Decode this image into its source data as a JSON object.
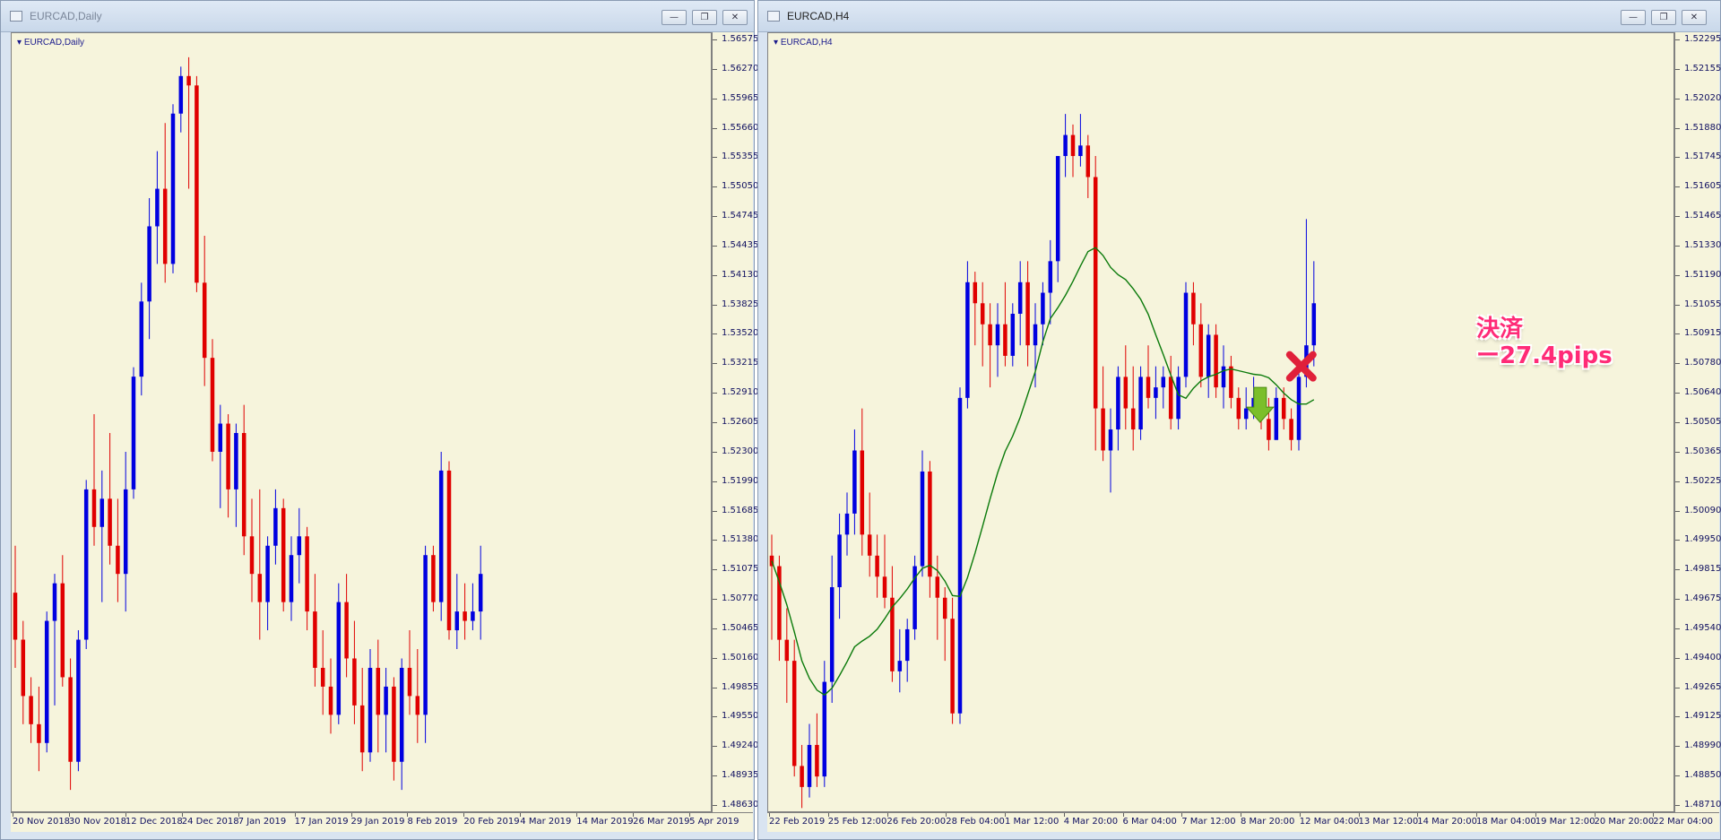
{
  "left_window": {
    "title": "EURCAD,Daily",
    "chart_label": "EURCAD,Daily",
    "price_labels": [
      "1.56575",
      "1.56270",
      "1.55965",
      "1.55660",
      "1.55355",
      "1.55050",
      "1.54745",
      "1.54435",
      "1.54130",
      "1.53825",
      "1.53520",
      "1.53215",
      "1.52910",
      "1.52605",
      "1.52300",
      "1.51990",
      "1.51685",
      "1.51380",
      "1.51075",
      "1.50770",
      "1.50465",
      "1.50160",
      "1.49855",
      "1.49550",
      "1.49240",
      "1.48935",
      "1.48630"
    ],
    "time_labels": [
      "20 Nov 2018",
      "30 Nov 2018",
      "12 Dec 2018",
      "24 Dec 2018",
      "7 Jan 2019",
      "17 Jan 2019",
      "29 Jan 2019",
      "8 Feb 2019",
      "20 Feb 2019",
      "4 Mar 2019",
      "14 Mar 2019",
      "26 Mar 2019",
      "5 Apr 2019"
    ]
  },
  "right_window": {
    "title": "EURCAD,H4",
    "chart_label": "EURCAD,H4",
    "price_labels": [
      "1.52295",
      "1.52155",
      "1.52020",
      "1.51880",
      "1.51745",
      "1.51605",
      "1.51465",
      "1.51330",
      "1.51190",
      "1.51055",
      "1.50915",
      "1.50780",
      "1.50640",
      "1.50505",
      "1.50365",
      "1.50225",
      "1.50090",
      "1.49950",
      "1.49815",
      "1.49675",
      "1.49540",
      "1.49400",
      "1.49265",
      "1.49125",
      "1.48990",
      "1.48850",
      "1.48710"
    ],
    "time_labels": [
      "22 Feb 2019",
      "25 Feb 12:00",
      "26 Feb 20:00",
      "28 Feb 04:00",
      "1 Mar 12:00",
      "4 Mar 20:00",
      "6 Mar 04:00",
      "7 Mar 12:00",
      "8 Mar 20:00",
      "12 Mar 04:00",
      "13 Mar 12:00",
      "14 Mar 20:00",
      "18 Mar 04:00",
      "19 Mar 12:00",
      "20 Mar 20:00",
      "22 Mar 04:00"
    ],
    "annotation": {
      "line1": "決済",
      "line2": "ー27.4pips"
    }
  },
  "window_buttons": {
    "minimize": "—",
    "restore": "❐",
    "close": "✕"
  },
  "colors": {
    "bull": "#0000e0",
    "bear": "#e00000",
    "ma": "#0a7a0a",
    "background": "#f6f4dc",
    "annotation": "#ff2b77"
  },
  "chart_data": [
    {
      "type": "candlestick",
      "title": "EURCAD,Daily",
      "ylim": [
        1.4863,
        1.5678
      ],
      "candles": [
        [
          1.509,
          1.514,
          1.501,
          1.504
        ],
        [
          1.504,
          1.506,
          1.495,
          1.498
        ],
        [
          1.498,
          1.5,
          1.493,
          1.495
        ],
        [
          1.495,
          1.499,
          1.49,
          1.493
        ],
        [
          1.493,
          1.507,
          1.492,
          1.506
        ],
        [
          1.506,
          1.511,
          1.497,
          1.51
        ],
        [
          1.51,
          1.513,
          1.499,
          1.5
        ],
        [
          1.5,
          1.502,
          1.488,
          1.491
        ],
        [
          1.491,
          1.505,
          1.49,
          1.504
        ],
        [
          1.504,
          1.521,
          1.503,
          1.52
        ],
        [
          1.52,
          1.528,
          1.514,
          1.516
        ],
        [
          1.516,
          1.522,
          1.508,
          1.519
        ],
        [
          1.519,
          1.526,
          1.512,
          1.514
        ],
        [
          1.514,
          1.519,
          1.508,
          1.511
        ],
        [
          1.511,
          1.524,
          1.507,
          1.52
        ],
        [
          1.52,
          1.533,
          1.519,
          1.532
        ],
        [
          1.532,
          1.542,
          1.53,
          1.54
        ],
        [
          1.54,
          1.551,
          1.536,
          1.548
        ],
        [
          1.548,
          1.556,
          1.544,
          1.552
        ],
        [
          1.552,
          1.559,
          1.542,
          1.544
        ],
        [
          1.544,
          1.561,
          1.543,
          1.56
        ],
        [
          1.56,
          1.565,
          1.558,
          1.564
        ],
        [
          1.564,
          1.566,
          1.552,
          1.563
        ],
        [
          1.563,
          1.564,
          1.541,
          1.542
        ],
        [
          1.542,
          1.547,
          1.531,
          1.534
        ],
        [
          1.534,
          1.536,
          1.523,
          1.524
        ],
        [
          1.524,
          1.529,
          1.518,
          1.527
        ],
        [
          1.527,
          1.528,
          1.517,
          1.52
        ],
        [
          1.52,
          1.527,
          1.516,
          1.526
        ],
        [
          1.526,
          1.529,
          1.513,
          1.515
        ],
        [
          1.515,
          1.519,
          1.508,
          1.511
        ],
        [
          1.511,
          1.52,
          1.504,
          1.508
        ],
        [
          1.508,
          1.515,
          1.505,
          1.514
        ],
        [
          1.514,
          1.52,
          1.512,
          1.518
        ],
        [
          1.518,
          1.519,
          1.507,
          1.508
        ],
        [
          1.508,
          1.515,
          1.506,
          1.513
        ],
        [
          1.513,
          1.518,
          1.51,
          1.515
        ],
        [
          1.515,
          1.516,
          1.505,
          1.507
        ],
        [
          1.507,
          1.511,
          1.499,
          1.501
        ],
        [
          1.501,
          1.505,
          1.496,
          1.499
        ],
        [
          1.499,
          1.502,
          1.494,
          1.496
        ],
        [
          1.496,
          1.51,
          1.495,
          1.508
        ],
        [
          1.508,
          1.511,
          1.5,
          1.502
        ],
        [
          1.502,
          1.506,
          1.495,
          1.497
        ],
        [
          1.497,
          1.501,
          1.49,
          1.492
        ],
        [
          1.492,
          1.503,
          1.491,
          1.501
        ],
        [
          1.501,
          1.504,
          1.492,
          1.496
        ],
        [
          1.496,
          1.501,
          1.492,
          1.499
        ],
        [
          1.499,
          1.5,
          1.489,
          1.491
        ],
        [
          1.491,
          1.502,
          1.488,
          1.501
        ],
        [
          1.501,
          1.505,
          1.496,
          1.498
        ],
        [
          1.498,
          1.503,
          1.493,
          1.496
        ],
        [
          1.496,
          1.514,
          1.493,
          1.513
        ],
        [
          1.513,
          1.514,
          1.507,
          1.508
        ],
        [
          1.508,
          1.524,
          1.506,
          1.522
        ],
        [
          1.522,
          1.523,
          1.504,
          1.505
        ],
        [
          1.505,
          1.511,
          1.503,
          1.507
        ],
        [
          1.507,
          1.51,
          1.504,
          1.506
        ],
        [
          1.506,
          1.51,
          1.505,
          1.507
        ],
        [
          1.507,
          1.514,
          1.504,
          1.511
        ]
      ]
    },
    {
      "type": "candlestick",
      "title": "EURCAD,H4",
      "ylim": [
        1.4871,
        1.5235
      ],
      "moving_average": "green line",
      "candles": [
        [
          1.499,
          1.5,
          1.495,
          1.4985
        ],
        [
          1.4985,
          1.499,
          1.494,
          1.495
        ],
        [
          1.495,
          1.4965,
          1.492,
          1.494
        ],
        [
          1.494,
          1.495,
          1.4885,
          1.489
        ],
        [
          1.489,
          1.49,
          1.487,
          1.488
        ],
        [
          1.488,
          1.491,
          1.4875,
          1.49
        ],
        [
          1.49,
          1.4915,
          1.488,
          1.4885
        ],
        [
          1.4885,
          1.494,
          1.488,
          1.493
        ],
        [
          1.493,
          1.499,
          1.492,
          1.4975
        ],
        [
          1.4975,
          1.501,
          1.496,
          1.5
        ],
        [
          1.5,
          1.502,
          1.499,
          1.501
        ],
        [
          1.501,
          1.505,
          1.5,
          1.504
        ],
        [
          1.504,
          1.506,
          1.499,
          1.5
        ],
        [
          1.5,
          1.502,
          1.498,
          1.499
        ],
        [
          1.499,
          1.5,
          1.497,
          1.498
        ],
        [
          1.498,
          1.5,
          1.4965,
          1.497
        ],
        [
          1.497,
          1.4985,
          1.493,
          1.4935
        ],
        [
          1.4935,
          1.4955,
          1.4925,
          1.494
        ],
        [
          1.494,
          1.496,
          1.493,
          1.4955
        ],
        [
          1.4955,
          1.499,
          1.495,
          1.4985
        ],
        [
          1.4985,
          1.504,
          1.498,
          1.503
        ],
        [
          1.503,
          1.5035,
          1.497,
          1.498
        ],
        [
          1.498,
          1.499,
          1.495,
          1.497
        ],
        [
          1.497,
          1.4975,
          1.494,
          1.496
        ],
        [
          1.496,
          1.497,
          1.491,
          1.4915
        ],
        [
          1.4915,
          1.507,
          1.491,
          1.5065
        ],
        [
          1.5065,
          1.513,
          1.506,
          1.512
        ],
        [
          1.512,
          1.5125,
          1.509,
          1.511
        ],
        [
          1.511,
          1.512,
          1.508,
          1.51
        ],
        [
          1.51,
          1.511,
          1.507,
          1.509
        ],
        [
          1.509,
          1.511,
          1.5075,
          1.51
        ],
        [
          1.51,
          1.512,
          1.508,
          1.5085
        ],
        [
          1.5085,
          1.511,
          1.508,
          1.5105
        ],
        [
          1.5105,
          1.513,
          1.509,
          1.512
        ],
        [
          1.512,
          1.513,
          1.508,
          1.509
        ],
        [
          1.509,
          1.511,
          1.507,
          1.51
        ],
        [
          1.51,
          1.512,
          1.509,
          1.5115
        ],
        [
          1.5115,
          1.514,
          1.51,
          1.513
        ],
        [
          1.513,
          1.518,
          1.512,
          1.518
        ],
        [
          1.518,
          1.52,
          1.517,
          1.519
        ],
        [
          1.519,
          1.5195,
          1.517,
          1.518
        ],
        [
          1.518,
          1.52,
          1.5175,
          1.5185
        ],
        [
          1.5185,
          1.519,
          1.516,
          1.517
        ],
        [
          1.517,
          1.518,
          1.504,
          1.506
        ],
        [
          1.506,
          1.508,
          1.5035,
          1.504
        ],
        [
          1.504,
          1.506,
          1.502,
          1.505
        ],
        [
          1.505,
          1.508,
          1.504,
          1.5075
        ],
        [
          1.5075,
          1.509,
          1.505,
          1.506
        ],
        [
          1.506,
          1.508,
          1.504,
          1.505
        ],
        [
          1.505,
          1.508,
          1.5045,
          1.5075
        ],
        [
          1.5075,
          1.509,
          1.506,
          1.5065
        ],
        [
          1.5065,
          1.508,
          1.5055,
          1.507
        ],
        [
          1.507,
          1.508,
          1.506,
          1.5075
        ],
        [
          1.5075,
          1.5085,
          1.505,
          1.5055
        ],
        [
          1.5055,
          1.508,
          1.505,
          1.5075
        ],
        [
          1.5075,
          1.512,
          1.507,
          1.5115
        ],
        [
          1.5115,
          1.512,
          1.509,
          1.51
        ],
        [
          1.51,
          1.511,
          1.507,
          1.5075
        ],
        [
          1.5075,
          1.51,
          1.5065,
          1.5095
        ],
        [
          1.5095,
          1.51,
          1.5065,
          1.507
        ],
        [
          1.507,
          1.509,
          1.506,
          1.508
        ],
        [
          1.508,
          1.5085,
          1.506,
          1.5065
        ],
        [
          1.5065,
          1.507,
          1.505,
          1.5055
        ],
        [
          1.5055,
          1.507,
          1.505,
          1.506
        ],
        [
          1.506,
          1.5075,
          1.5055,
          1.5065
        ],
        [
          1.5065,
          1.507,
          1.505,
          1.5055
        ],
        [
          1.5055,
          1.5065,
          1.504,
          1.5045
        ],
        [
          1.5045,
          1.507,
          1.5045,
          1.5065
        ],
        [
          1.5065,
          1.507,
          1.505,
          1.5055
        ],
        [
          1.5055,
          1.506,
          1.504,
          1.5045
        ],
        [
          1.5045,
          1.508,
          1.504,
          1.5075
        ],
        [
          1.5075,
          1.515,
          1.507,
          1.509
        ],
        [
          1.509,
          1.513,
          1.508,
          1.511
        ]
      ]
    }
  ]
}
